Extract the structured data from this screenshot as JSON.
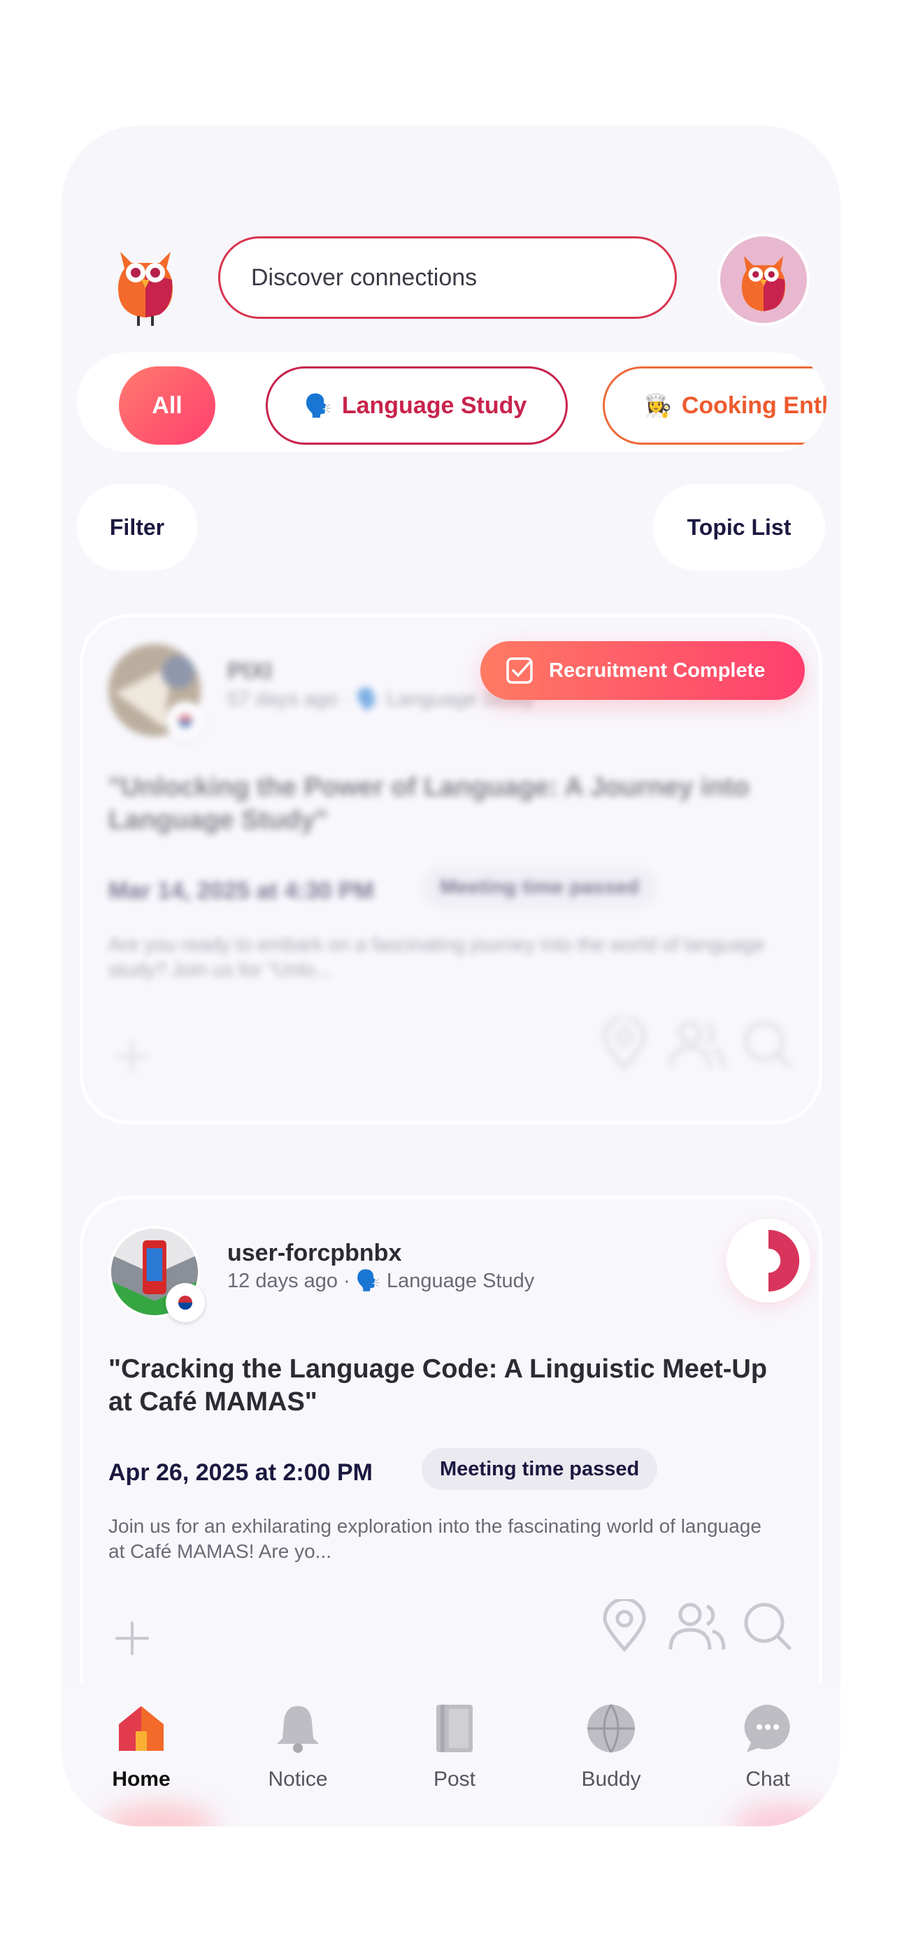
{
  "header": {
    "search_placeholder": "Discover connections"
  },
  "categories": [
    {
      "label": "All",
      "emoji": ""
    },
    {
      "label": "Language Study",
      "emoji": "🗣️"
    },
    {
      "label": "Cooking Enth",
      "emoji": "👩‍🍳"
    }
  ],
  "toolbar": {
    "filter_label": "Filter",
    "topic_list_label": "Topic List"
  },
  "posts": [
    {
      "username": "PIXI",
      "time_ago": "57 days ago",
      "separator": "·",
      "category_emoji": "🗣️",
      "category": "Language Study",
      "title": "\"Unlocking the Power of Language: A Journey into Language Study\"",
      "date": "Mar 14, 2025 at 4:30 PM",
      "status": "Meeting time passed",
      "description": "Are you ready to embark on a fascinating journey into the world of language study? Join us for \"Unlo...",
      "badge": "Recruitment Complete"
    },
    {
      "username": "user-forcpbnbx",
      "time_ago": "12 days ago",
      "separator": "·",
      "category_emoji": "🗣️",
      "category": "Language Study",
      "title": "\"Cracking the Language Code: A Linguistic Meet-Up at Café MAMAS\"",
      "date": "Apr 26, 2025 at 2:00 PM",
      "status": "Meeting time passed",
      "description": "Join us for an exhilarating exploration into the fascinating world of language at Café MAMAS! Are yo..."
    }
  ],
  "nav": {
    "items": [
      {
        "label": "Home",
        "icon": "home-icon"
      },
      {
        "label": "Notice",
        "icon": "bell-icon"
      },
      {
        "label": "Post",
        "icon": "book-icon"
      },
      {
        "label": "Buddy",
        "icon": "globe-icon"
      },
      {
        "label": "Chat",
        "icon": "chat-bubble-icon"
      }
    ]
  },
  "colors": {
    "accent": "#ff4f6d",
    "brand_red": "#c8234c",
    "brand_orange": "#ee5a2e",
    "text_dark": "#1b1840"
  }
}
